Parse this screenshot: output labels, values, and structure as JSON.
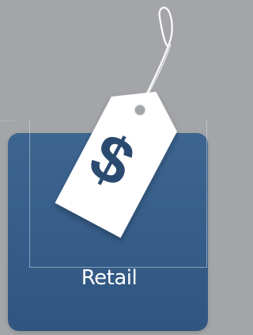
{
  "tile": {
    "label": "Retail",
    "icon": "price-tag-icon",
    "symbol": "$"
  },
  "colors": {
    "background": "#a3a5a8",
    "tile": "#365d89",
    "tag": "#ffffff",
    "symbol": "#2b4a70",
    "label": "#ffffff"
  }
}
